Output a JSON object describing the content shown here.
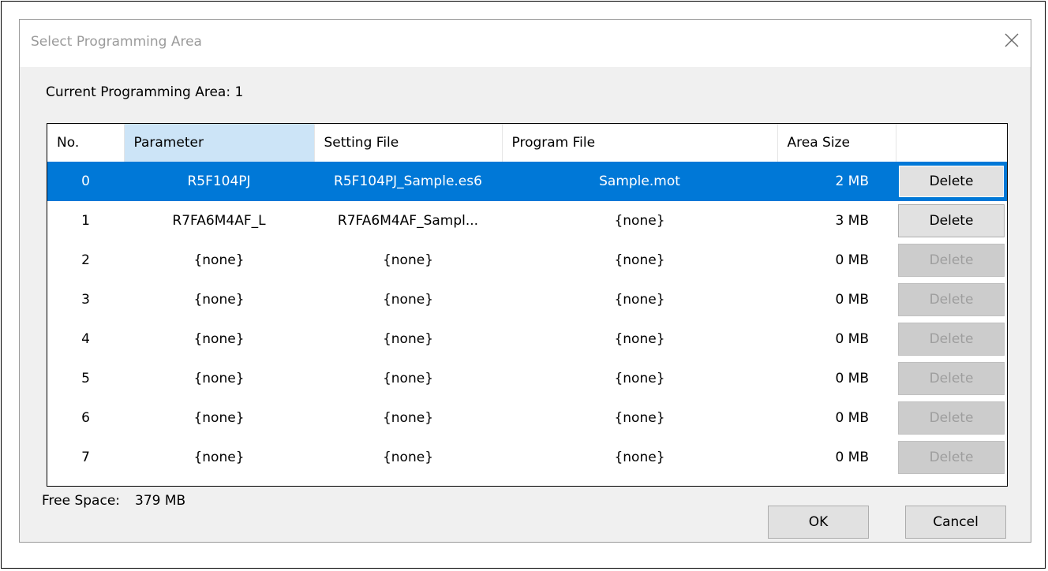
{
  "dialog": {
    "title": "Select Programming Area",
    "current_area_label": "Current Programming Area: 1"
  },
  "table": {
    "columns": [
      "No.",
      "Parameter",
      "Setting File",
      "Program File",
      "Area Size",
      ""
    ],
    "rows": [
      {
        "no": "0",
        "parameter": "R5F104PJ",
        "setting_file": "R5F104PJ_Sample.es6",
        "program_file": "Sample.mot",
        "area_size": "2 MB",
        "delete_label": "Delete",
        "selected": true,
        "delete_enabled": true
      },
      {
        "no": "1",
        "parameter": "R7FA6M4AF_L",
        "setting_file": "R7FA6M4AF_Sampl...",
        "program_file": "{none}",
        "area_size": "3 MB",
        "delete_label": "Delete",
        "selected": false,
        "delete_enabled": true
      },
      {
        "no": "2",
        "parameter": "{none}",
        "setting_file": "{none}",
        "program_file": "{none}",
        "area_size": "0 MB",
        "delete_label": "Delete",
        "selected": false,
        "delete_enabled": false
      },
      {
        "no": "3",
        "parameter": "{none}",
        "setting_file": "{none}",
        "program_file": "{none}",
        "area_size": "0 MB",
        "delete_label": "Delete",
        "selected": false,
        "delete_enabled": false
      },
      {
        "no": "4",
        "parameter": "{none}",
        "setting_file": "{none}",
        "program_file": "{none}",
        "area_size": "0 MB",
        "delete_label": "Delete",
        "selected": false,
        "delete_enabled": false
      },
      {
        "no": "5",
        "parameter": "{none}",
        "setting_file": "{none}",
        "program_file": "{none}",
        "area_size": "0 MB",
        "delete_label": "Delete",
        "selected": false,
        "delete_enabled": false
      },
      {
        "no": "6",
        "parameter": "{none}",
        "setting_file": "{none}",
        "program_file": "{none}",
        "area_size": "0 MB",
        "delete_label": "Delete",
        "selected": false,
        "delete_enabled": false
      },
      {
        "no": "7",
        "parameter": "{none}",
        "setting_file": "{none}",
        "program_file": "{none}",
        "area_size": "0 MB",
        "delete_label": "Delete",
        "selected": false,
        "delete_enabled": false
      }
    ]
  },
  "footer": {
    "free_space_label": "Free Space:",
    "free_space_value": "379 MB",
    "ok_label": "OK",
    "cancel_label": "Cancel"
  },
  "colors": {
    "selection": "#0078d7",
    "sorted_header": "#cce4f7"
  },
  "icons": {
    "close": "close-icon"
  }
}
